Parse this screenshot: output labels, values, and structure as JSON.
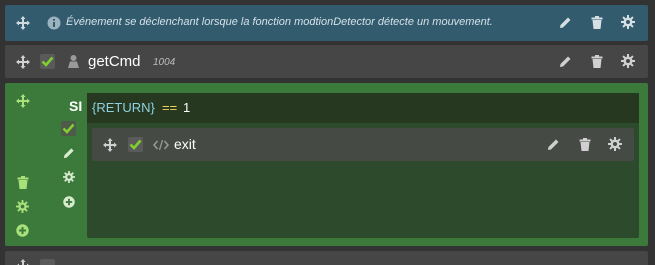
{
  "comment": {
    "text": "Événement se déclenchant lorsque la fonction modtionDetector détecte un mouvement.",
    "icons": [
      "move-icon",
      "info-icon",
      "pencil-icon",
      "trash-icon",
      "gear-icon"
    ]
  },
  "command": {
    "name": "getCmd",
    "id": "1004",
    "checked": true,
    "icons": [
      "move-icon",
      "checkbox-icon",
      "user-icon",
      "pencil-icon",
      "trash-icon",
      "gear-icon"
    ]
  },
  "si_block": {
    "label": "SI",
    "condition": {
      "variable": "{RETURN}",
      "operator": "==",
      "value": "1"
    },
    "inner_command": {
      "name": "exit",
      "checked": true
    }
  },
  "colors": {
    "comment_bg": "#335b6e",
    "row_bg": "#464646",
    "si_bg": "#3c7a3c",
    "check_green": "#7fd02f",
    "icon_gray": "#c8c8c8"
  }
}
